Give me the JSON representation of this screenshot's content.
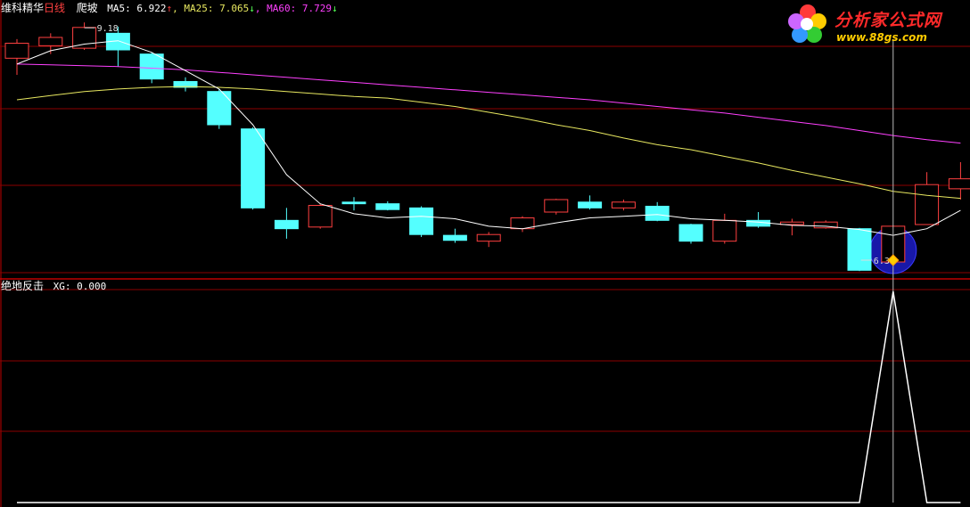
{
  "header": {
    "stock_name": "维科精华",
    "period": "日线",
    "indicator": "爬坡",
    "ma5_label": "MA5: 6.922",
    "ma5_arrow": "↑",
    "ma25_label": ", MA25: 7.065",
    "ma25_arrow": "↓",
    "ma60_label": ", MA60: 7.729",
    "ma60_arrow": "↓"
  },
  "sub_header": {
    "indicator": "绝地反击",
    "xg_label": "XG: 0.000"
  },
  "logo": {
    "title": "分析家公式网",
    "url": "www.88gs.com"
  },
  "colors": {
    "up": "#ff4040",
    "down": "#54ffff",
    "ma5": "#ffffff",
    "ma25": "#e8e860",
    "ma60": "#ff40ff",
    "grid": "#8b0000",
    "signal": "#ffffff",
    "marker_circle": "#1818a8"
  },
  "chart_data": [
    {
      "type": "candlestick",
      "title": "",
      "annotations": [
        {
          "text": "9.18",
          "at_candle": 2,
          "kind": "high"
        },
        {
          "text": "6.3",
          "at_candle": 26,
          "kind": "low"
        }
      ],
      "ylim": [
        6.15,
        9.3
      ],
      "candles": [
        {
          "o": 8.75,
          "c": 8.93,
          "h": 8.98,
          "l": 8.55
        },
        {
          "o": 8.9,
          "c": 9.0,
          "h": 9.05,
          "l": 8.8
        },
        {
          "o": 8.87,
          "c": 9.12,
          "h": 9.18,
          "l": 8.85
        },
        {
          "o": 9.05,
          "c": 8.85,
          "h": 9.13,
          "l": 8.65
        },
        {
          "o": 8.8,
          "c": 8.5,
          "h": 8.82,
          "l": 8.45
        },
        {
          "o": 8.47,
          "c": 8.4,
          "h": 8.52,
          "l": 8.35
        },
        {
          "o": 8.35,
          "c": 7.95,
          "h": 8.38,
          "l": 7.9
        },
        {
          "o": 7.9,
          "c": 6.95,
          "h": 7.92,
          "l": 6.93
        },
        {
          "o": 6.8,
          "c": 6.7,
          "h": 6.95,
          "l": 6.58
        },
        {
          "o": 6.72,
          "c": 6.98,
          "h": 7.0,
          "l": 6.7
        },
        {
          "o": 7.02,
          "c": 7.0,
          "h": 7.08,
          "l": 6.92
        },
        {
          "o": 7.0,
          "c": 6.93,
          "h": 7.03,
          "l": 6.92
        },
        {
          "o": 6.95,
          "c": 6.63,
          "h": 6.97,
          "l": 6.6
        },
        {
          "o": 6.62,
          "c": 6.56,
          "h": 6.7,
          "l": 6.53
        },
        {
          "o": 6.55,
          "c": 6.63,
          "h": 6.66,
          "l": 6.48
        },
        {
          "o": 6.7,
          "c": 6.83,
          "h": 6.85,
          "l": 6.66
        },
        {
          "o": 6.9,
          "c": 7.05,
          "h": 7.06,
          "l": 6.87
        },
        {
          "o": 7.02,
          "c": 6.95,
          "h": 7.1,
          "l": 6.93
        },
        {
          "o": 6.95,
          "c": 7.02,
          "h": 7.05,
          "l": 6.92
        },
        {
          "o": 6.97,
          "c": 6.8,
          "h": 7.02,
          "l": 6.79
        },
        {
          "o": 6.75,
          "c": 6.55,
          "h": 6.76,
          "l": 6.52
        },
        {
          "o": 6.55,
          "c": 6.8,
          "h": 6.88,
          "l": 6.52
        },
        {
          "o": 6.8,
          "c": 6.73,
          "h": 6.9,
          "l": 6.71
        },
        {
          "o": 6.75,
          "c": 6.78,
          "h": 6.82,
          "l": 6.62
        },
        {
          "o": 6.71,
          "c": 6.78,
          "h": 6.8,
          "l": 6.7
        },
        {
          "o": 6.7,
          "c": 6.2,
          "h": 6.71,
          "l": 6.19
        },
        {
          "o": 6.3,
          "c": 6.73,
          "h": 6.74,
          "l": 6.3
        },
        {
          "o": 6.75,
          "c": 7.23,
          "h": 7.38,
          "l": 6.75
        },
        {
          "o": 7.18,
          "c": 7.3,
          "h": 7.5,
          "l": 7.05
        }
      ],
      "ma5": [
        8.68,
        8.84,
        8.92,
        8.96,
        8.82,
        8.6,
        8.38,
        7.95,
        7.35,
        7.0,
        6.88,
        6.83,
        6.85,
        6.82,
        6.73,
        6.7,
        6.77,
        6.83,
        6.85,
        6.87,
        6.82,
        6.8,
        6.78,
        6.74,
        6.73,
        6.69,
        6.62,
        6.7,
        6.92
      ],
      "ma25": [
        8.25,
        8.3,
        8.35,
        8.38,
        8.4,
        8.41,
        8.4,
        8.38,
        8.35,
        8.32,
        8.29,
        8.27,
        8.22,
        8.17,
        8.1,
        8.03,
        7.95,
        7.88,
        7.79,
        7.71,
        7.65,
        7.57,
        7.49,
        7.4,
        7.32,
        7.24,
        7.15,
        7.1,
        7.065
      ],
      "ma60": [
        8.68,
        8.67,
        8.66,
        8.65,
        8.63,
        8.61,
        8.58,
        8.55,
        8.52,
        8.49,
        8.46,
        8.43,
        8.4,
        8.37,
        8.34,
        8.31,
        8.28,
        8.25,
        8.21,
        8.17,
        8.13,
        8.09,
        8.04,
        7.99,
        7.94,
        7.88,
        7.82,
        7.77,
        7.729
      ]
    },
    {
      "type": "line",
      "title": "",
      "series": [
        {
          "values": [
            0,
            0,
            0,
            0,
            0,
            0,
            0,
            0,
            0,
            0,
            0,
            0,
            0,
            0,
            0,
            0,
            0,
            0,
            0,
            0,
            0,
            0,
            0,
            0,
            0,
            0,
            1,
            0,
            0
          ]
        }
      ],
      "ylim": [
        0,
        1
      ]
    }
  ]
}
